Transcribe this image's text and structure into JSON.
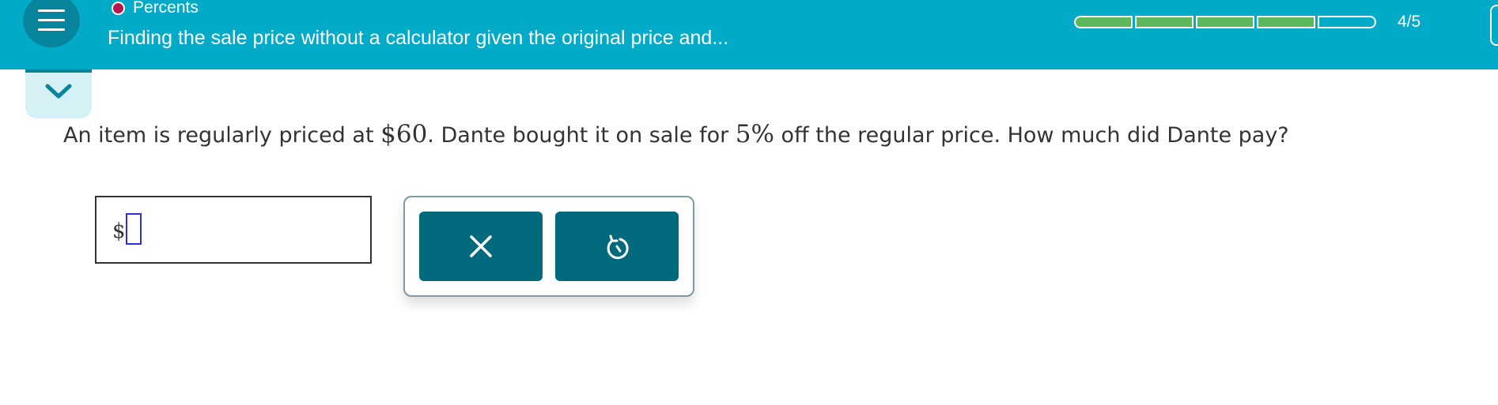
{
  "header": {
    "topic": "Percents",
    "lesson_title": "Finding the sale price without a calculator given the original price and...",
    "progress": {
      "completed": 4,
      "total": 5,
      "label": "4/5"
    }
  },
  "question": {
    "text_1": "An item is regularly priced at ",
    "price": "$60",
    "text_2": ". Dante bought it on sale for ",
    "discount": "5%",
    "text_3": " off the regular price. How much did Dante pay?"
  },
  "answer": {
    "currency_symbol": "$",
    "value": ""
  },
  "tools": {
    "clear_icon": "x-icon",
    "undo_icon": "undo-icon"
  },
  "colors": {
    "header_bg": "#01abc8",
    "menu_button": "#06859c",
    "topic_dot": "#b7174f",
    "progress_filled": "#5cb85c",
    "tool_button": "#006a7c",
    "collapse_tab": "#d5f1f6"
  }
}
